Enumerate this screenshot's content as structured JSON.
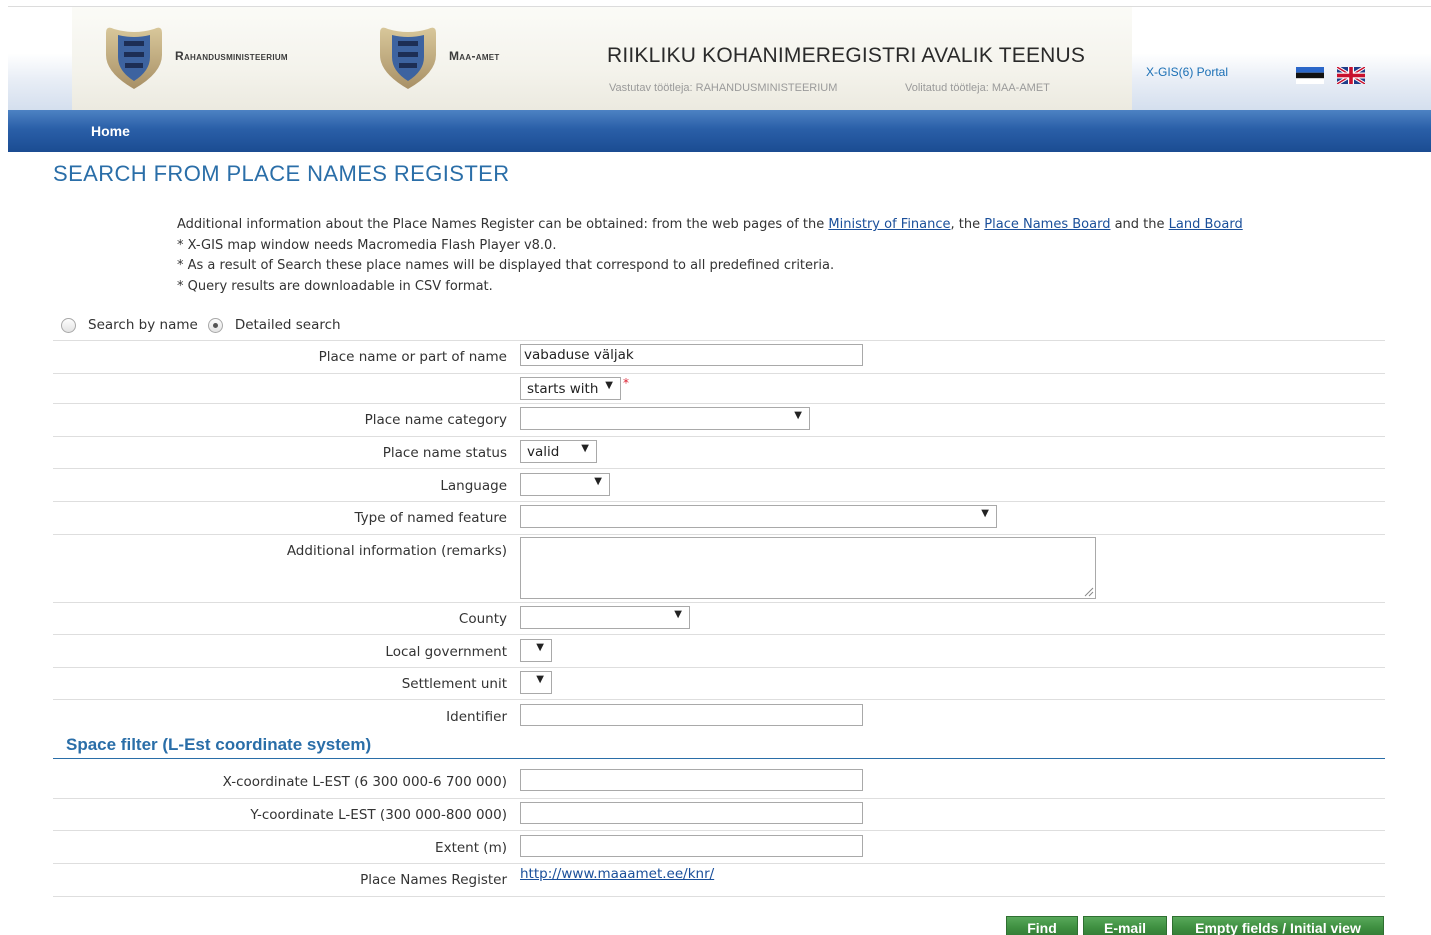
{
  "header": {
    "org1": "Rahandusministeerium",
    "org2": "Maa-amet",
    "title": "RIIKLIKU KOHANIMEREGISTRI AVALIK TEENUS",
    "responsible": "Vastutav töötleja: RAHANDUSMINISTEERIUM",
    "authorized": "Volitatud töötleja: MAA-AMET",
    "portal_link": "X-GIS(6) Portal",
    "flags": [
      "estonian-flag-icon",
      "uk-flag-icon"
    ]
  },
  "nav": {
    "home": "Home"
  },
  "page": {
    "title": "SEARCH FROM PLACE NAMES REGISTER",
    "info": {
      "prefix": "Additional information about the Place Names Register can be obtained: from the web pages of the",
      "link1": "Ministry of Finance",
      "mid1": ", the",
      "link2": "Place Names Board",
      "mid2": "and the",
      "link3": "Land Board",
      "note1": "* X-GIS map window needs Macromedia Flash Player v8.0.",
      "note2": "* As a result of Search these place names will be displayed that correspond to all predefined criteria.",
      "note3": "* Query results are downloadable in CSV format."
    }
  },
  "search_mode": {
    "by_name": "Search by name",
    "detailed": "Detailed search",
    "selected": "detailed"
  },
  "form": {
    "place_name_label": "Place name or part of name",
    "place_name_value": "vabaduse väljak",
    "match_mode": "starts with",
    "required_mark": "*",
    "category_label": "Place name category",
    "category_value": "",
    "status_label": "Place name status",
    "status_value": "valid",
    "language_label": "Language",
    "language_value": "",
    "feature_type_label": "Type of named feature",
    "feature_type_value": "",
    "remarks_label": "Additional information (remarks)",
    "remarks_value": "",
    "county_label": "County",
    "county_value": "",
    "local_gov_label": "Local government",
    "local_gov_value": "",
    "settlement_label": "Settlement unit",
    "settlement_value": "",
    "identifier_label": "Identifier",
    "identifier_value": ""
  },
  "space_filter": {
    "title": "Space filter (L-Est coordinate system)",
    "x_label": "X-coordinate L-EST (6 300 000-6 700 000)",
    "x_value": "",
    "y_label": "Y-coordinate L-EST (300 000-800 000)",
    "y_value": "",
    "extent_label": "Extent (m)",
    "extent_value": "",
    "register_label": "Place Names Register",
    "register_link": "http://www.maaamet.ee/knr/"
  },
  "buttons": {
    "find": "Find",
    "email": "E-mail",
    "reset": "Empty fields / Initial view"
  },
  "colors": {
    "nav_blue": "#2a5fa8",
    "title_blue": "#2a6ea8",
    "button_green": "#3e8f40",
    "link": "#1a4f9a"
  }
}
